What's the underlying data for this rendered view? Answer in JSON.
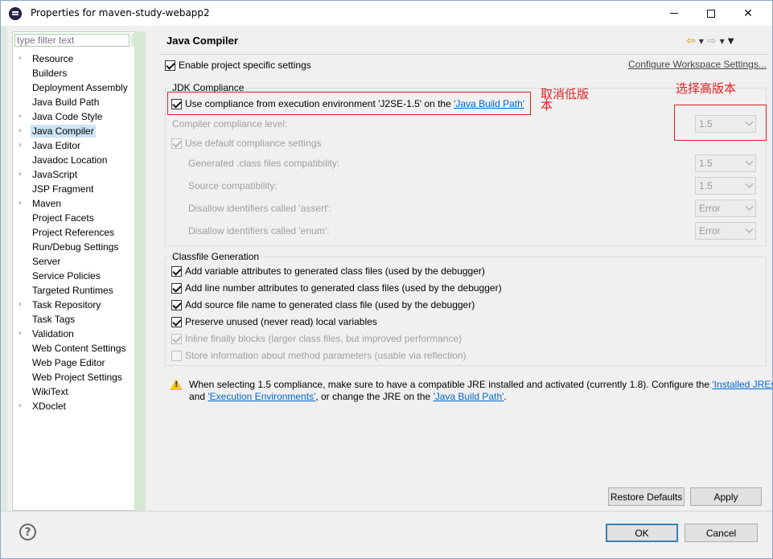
{
  "window": {
    "title": "Properties for maven-study-webapp2",
    "minimize_icon": "minimize-icon",
    "maximize_icon": "maximize-icon",
    "close_icon": "close-icon"
  },
  "filter": {
    "placeholder": "type filter text"
  },
  "tree": {
    "items": [
      {
        "label": "Resource",
        "expandable": true
      },
      {
        "label": "Builders",
        "expandable": false
      },
      {
        "label": "Deployment Assembly",
        "expandable": false
      },
      {
        "label": "Java Build Path",
        "expandable": false
      },
      {
        "label": "Java Code Style",
        "expandable": true
      },
      {
        "label": "Java Compiler",
        "expandable": true,
        "selected": true
      },
      {
        "label": "Java Editor",
        "expandable": true
      },
      {
        "label": "Javadoc Location",
        "expandable": false
      },
      {
        "label": "JavaScript",
        "expandable": true
      },
      {
        "label": "JSP Fragment",
        "expandable": false
      },
      {
        "label": "Maven",
        "expandable": true
      },
      {
        "label": "Project Facets",
        "expandable": false
      },
      {
        "label": "Project References",
        "expandable": false
      },
      {
        "label": "Run/Debug Settings",
        "expandable": false
      },
      {
        "label": "Server",
        "expandable": false
      },
      {
        "label": "Service Policies",
        "expandable": false
      },
      {
        "label": "Targeted Runtimes",
        "expandable": false
      },
      {
        "label": "Task Repository",
        "expandable": true
      },
      {
        "label": "Task Tags",
        "expandable": false
      },
      {
        "label": "Validation",
        "expandable": true
      },
      {
        "label": "Web Content Settings",
        "expandable": false
      },
      {
        "label": "Web Page Editor",
        "expandable": false
      },
      {
        "label": "Web Project Settings",
        "expandable": false
      },
      {
        "label": "WikiText",
        "expandable": false
      },
      {
        "label": "XDoclet",
        "expandable": true
      }
    ]
  },
  "page": {
    "title": "Java Compiler",
    "enable_specific": "Enable project specific settings",
    "configure_link": "Configure Workspace Settings...",
    "jdk_group": {
      "label": "JDK Compliance",
      "use_compliance_prefix": "Use compliance from execution environment 'J2SE-1.5' on the ",
      "use_compliance_link": "'Java Build Path'",
      "compliance_level_label": "Compiler compliance level:",
      "compliance_level_value": "1.5",
      "use_default": "Use default compliance settings",
      "generated_label": "Generated .class files compatibility:",
      "generated_value": "1.5",
      "source_label": "Source compatibility:",
      "source_value": "1.5",
      "assert_label": "Disallow identifiers called 'assert':",
      "assert_value": "Error",
      "enum_label": "Disallow identifiers called 'enum':",
      "enum_value": "Error"
    },
    "classfile_group": {
      "label": "Classfile Generation",
      "options": [
        {
          "label": "Add variable attributes to generated class files (used by the debugger)",
          "checked": true,
          "enabled": true
        },
        {
          "label": "Add line number attributes to generated class files (used by the debugger)",
          "checked": true,
          "enabled": true
        },
        {
          "label": "Add source file name to generated class file (used by the debugger)",
          "checked": true,
          "enabled": true
        },
        {
          "label": "Preserve unused (never read) local variables",
          "checked": true,
          "enabled": true
        },
        {
          "label": "Inline finally blocks (larger class files, but improved performance)",
          "checked": true,
          "enabled": false
        },
        {
          "label": "Store information about method parameters (usable via reflection)",
          "checked": false,
          "enabled": false
        }
      ]
    },
    "warning": {
      "line1_prefix": "When selecting 1.5 compliance, make sure to have a compatible JRE installed and activated (currently 1.8). Configure the ",
      "line1_link": "'Installed JREs'",
      "line2_and": "and ",
      "line2_link1": "'Execution Environments'",
      "line2_mid": ", or change the JRE on the ",
      "line2_link2": "'Java Build Path'",
      "line2_end": "."
    }
  },
  "buttons": {
    "restore_defaults": "Restore Defaults",
    "apply": "Apply",
    "ok": "OK",
    "cancel": "Cancel"
  },
  "annotations": {
    "cancel_low_line1": "取消低版",
    "cancel_low_line2": "本",
    "choose_high": "选择高版本"
  }
}
